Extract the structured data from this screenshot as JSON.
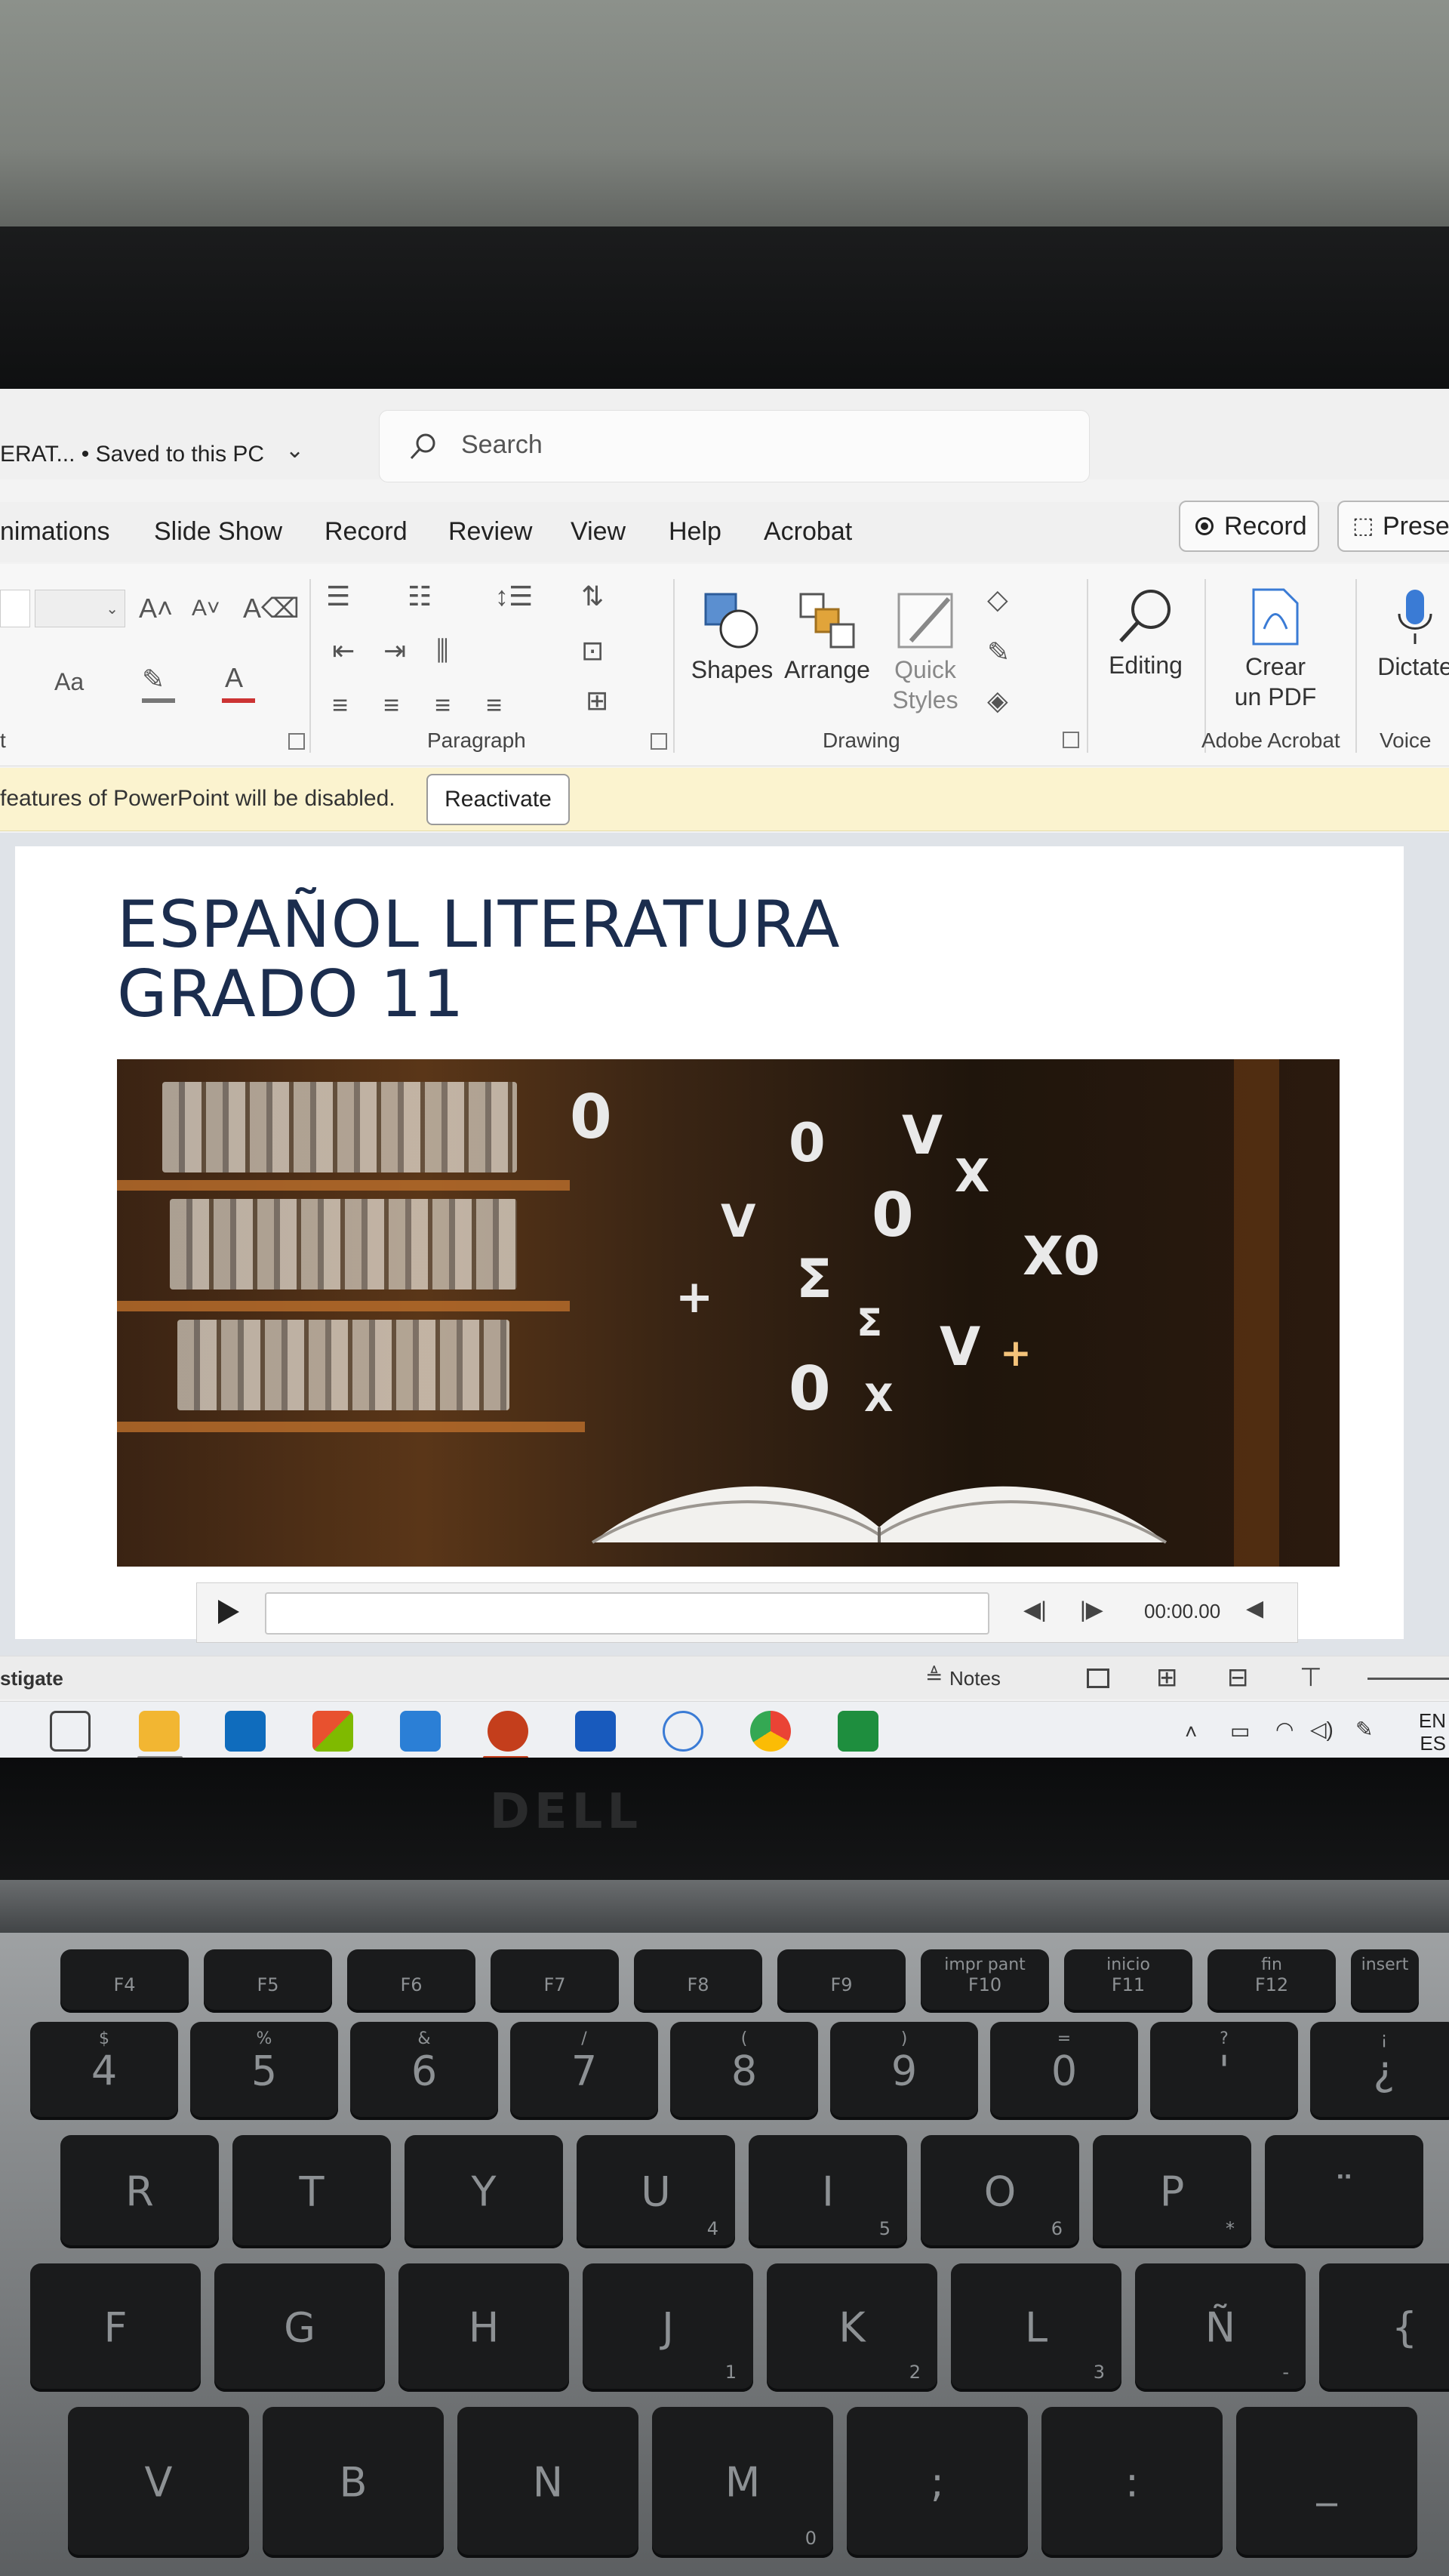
{
  "window": {
    "doc_title": "ERAT... • Saved to this PC",
    "search_placeholder": "Search"
  },
  "menu": {
    "tabs": [
      "nimations",
      "Slide Show",
      "Record",
      "Review",
      "View",
      "Help",
      "Acrobat"
    ],
    "record_button": "Record",
    "present_button": "Preser"
  },
  "ribbon": {
    "font_case": "Aa",
    "buttons": {
      "shapes": "Shapes",
      "arrange": "Arrange",
      "quick_styles_1": "Quick",
      "quick_styles_2": "Styles",
      "editing": "Editing",
      "crear_pdf_1": "Crear",
      "crear_pdf_2": "un PDF",
      "dictate": "Dictate"
    },
    "groups": {
      "font": "t",
      "paragraph": "Paragraph",
      "drawing": "Drawing",
      "adobe": "Adobe Acrobat",
      "voice": "Voice"
    }
  },
  "message_bar": {
    "text": "features of PowerPoint will be disabled.",
    "button": "Reactivate"
  },
  "slide": {
    "title_line1": "ESPAÑOL LITERATURA",
    "title_line2": "GRADO 11",
    "media_time": "00:00.00"
  },
  "statusbar": {
    "left": "stigate",
    "notes": "Notes"
  },
  "taskbar": {
    "lang_1": "EN",
    "lang_2": "ES"
  },
  "hardware": {
    "brand": "DELL"
  },
  "keyboard": {
    "fkeys": [
      "F4",
      "F5",
      "F6",
      "F7",
      "F8",
      "F9",
      "F10",
      "F11",
      "F12"
    ],
    "fkeys_top": [
      "",
      "",
      "",
      "",
      "",
      "",
      "impr pant",
      "inicio",
      "fin",
      "insert"
    ],
    "fkey_last": "insert",
    "num_row": [
      {
        "main": "4",
        "top": "$"
      },
      {
        "main": "5",
        "top": "%"
      },
      {
        "main": "6",
        "top": "&"
      },
      {
        "main": "7",
        "top": "/"
      },
      {
        "main": "8",
        "top": "("
      },
      {
        "main": "9",
        "top": ")"
      },
      {
        "main": "0",
        "top": "="
      },
      {
        "main": "'",
        "top": "?"
      },
      {
        "main": "¿",
        "top": "¡"
      }
    ],
    "row_q": [
      {
        "main": "R",
        "sub": ""
      },
      {
        "main": "T",
        "sub": ""
      },
      {
        "main": "Y",
        "sub": ""
      },
      {
        "main": "U",
        "sub": "4"
      },
      {
        "main": "I",
        "sub": "5"
      },
      {
        "main": "O",
        "sub": "6"
      },
      {
        "main": "P",
        "sub": "*"
      },
      {
        "main": "¨",
        "sub": ""
      }
    ],
    "row_a": [
      {
        "main": "F",
        "sub": ""
      },
      {
        "main": "G",
        "sub": ""
      },
      {
        "main": "H",
        "sub": ""
      },
      {
        "main": "J",
        "sub": "1"
      },
      {
        "main": "K",
        "sub": "2"
      },
      {
        "main": "L",
        "sub": "3"
      },
      {
        "main": "Ñ",
        "sub": "-"
      },
      {
        "main": "{",
        "sub": ""
      }
    ],
    "row_z": [
      {
        "main": "V",
        "sub": ""
      },
      {
        "main": "B",
        "sub": ""
      },
      {
        "main": "N",
        "sub": ""
      },
      {
        "main": "M",
        "sub": "0"
      },
      {
        "main": ";",
        "sub": ""
      },
      {
        "main": ":",
        "sub": ""
      },
      {
        "main": "_",
        "sub": ""
      }
    ]
  }
}
